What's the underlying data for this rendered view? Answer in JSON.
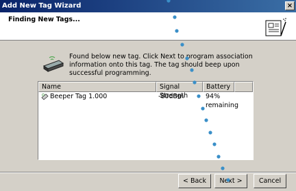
{
  "window": {
    "title": "Add New Tag Wizard",
    "close_label": "×"
  },
  "header": {
    "title": "Finding New Tags..."
  },
  "message": "Found below new tag. Click Next to program association information onto this tag. The tag should beep upon successful programming.",
  "list": {
    "columns": [
      "Name",
      "Signal Strength",
      "Battery"
    ],
    "rows": [
      {
        "name": "Beeper Tag 1.000",
        "signal": "-80dBm",
        "battery": "94% remaining"
      }
    ]
  },
  "buttons": {
    "back": {
      "label": "< Back",
      "mnemonic": "B"
    },
    "next": {
      "label": "Next >",
      "mnemonic": "N"
    },
    "cancel": {
      "label": "Cancel"
    }
  },
  "colors": {
    "titlebar": "#0a246a",
    "dots": "#3a8fc8"
  }
}
